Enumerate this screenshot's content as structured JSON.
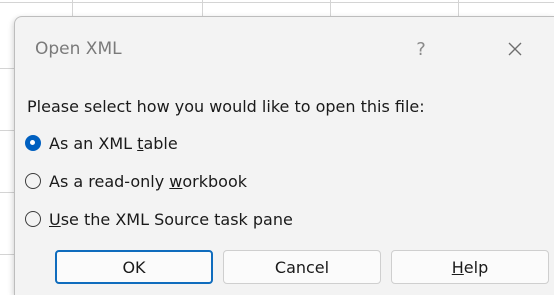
{
  "dialog": {
    "title": "Open XML",
    "help_glyph": "?",
    "close_icon": "close-icon",
    "prompt": "Please select how you would like to open this file:",
    "options": [
      {
        "pre": "As an XML ",
        "accel": "t",
        "post": "able",
        "selected": true
      },
      {
        "pre": "As a read-only ",
        "accel": "w",
        "post": "orkbook",
        "selected": false
      },
      {
        "pre": "",
        "accel": "U",
        "post": "se the XML Source task pane",
        "selected": false
      }
    ],
    "buttons": {
      "ok": "OK",
      "cancel": "Cancel",
      "help_pre": "",
      "help_accel": "H",
      "help_post": "elp"
    }
  },
  "colors": {
    "accent": "#0060c0",
    "dialog_bg": "#f3f3f3",
    "default_button_border": "#0f6cbd"
  }
}
